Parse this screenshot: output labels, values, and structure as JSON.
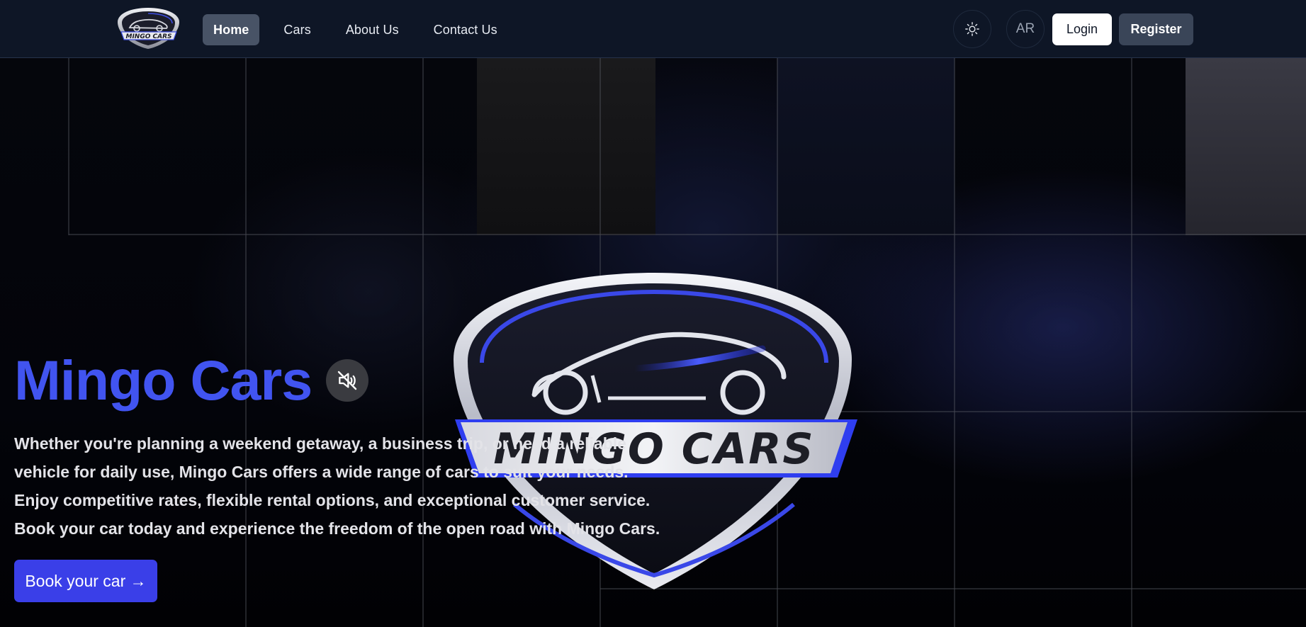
{
  "navbar": {
    "logo": {
      "name": "Mingo Cars logo",
      "text": "MINGO CARS"
    },
    "links": [
      {
        "label": "Home",
        "active": true
      },
      {
        "label": "Cars",
        "active": false
      },
      {
        "label": "About Us",
        "active": false
      },
      {
        "label": "Contact Us",
        "active": false
      }
    ],
    "theme_toggle_icon": "sun-icon",
    "language_label": "AR",
    "login_label": "Login",
    "register_label": "Register"
  },
  "hero": {
    "title": "Mingo Cars",
    "mute_icon": "muted-speaker-icon",
    "description": "Whether you're planning a weekend getaway, a business trip, or need a reliable vehicle for daily use, Mingo Cars offers a wide range of cars to suit your needs. Enjoy competitive rates, flexible rental options, and exceptional customer service. Book your car today and experience the freedom of the open road with Mingo Cars.",
    "cta_label": "Book your car →",
    "emblem_text": "MINGO CARS"
  },
  "colors": {
    "nav_bg": "#0e1626",
    "accent_blue": "#4154f0",
    "cta_blue": "#3a3fe8",
    "active_tab_bg": "#485366",
    "register_bg": "#3a4558"
  }
}
